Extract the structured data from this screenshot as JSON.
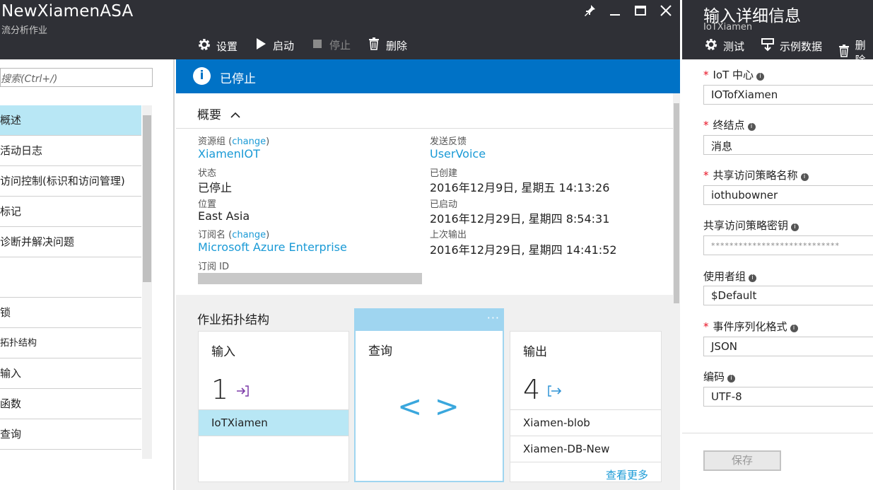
{
  "window": {
    "title": "NewXiamenASA",
    "subtitle": "流分析作业"
  },
  "toolbar": {
    "settings": "设置",
    "start": "启动",
    "stop": "停止",
    "delete": "删除"
  },
  "left": {
    "search_placeholder": "搜索(Ctrl+/)",
    "nav": [
      "概述",
      "活动日志",
      "访问控制(标识和访问管理)",
      "标记",
      "诊断并解决问题",
      "",
      "锁",
      "拓扑结构",
      "输入",
      "函数",
      "查询"
    ]
  },
  "banner": {
    "status": "已停止"
  },
  "essentials": {
    "header": "概要",
    "resource_group_label": "资源组",
    "change": "change",
    "resource_group": "XiamenIOT",
    "status_label": "状态",
    "status": "已停止",
    "location_label": "位置",
    "location": "East Asia",
    "subscription_label": "订阅名",
    "subscription": "Microsoft Azure Enterprise",
    "subscription_id_label": "订阅 ID",
    "feedback_label": "发送反馈",
    "feedback": "UserVoice",
    "created_label": "已创建",
    "created": "2016年12月9日, 星期五 14:13:26",
    "started_label": "已启动",
    "started": "2016年12月29日, 星期四 8:54:31",
    "last_output_label": "上次输出",
    "last_output": "2016年12月29日, 星期四 14:41:52"
  },
  "topology": {
    "title": "作业拓扑结构",
    "inputs": {
      "label": "输入",
      "count": "1",
      "items": [
        "IoTXiamen"
      ]
    },
    "query": {
      "label": "查询",
      "glyph": "< >",
      "more": "···"
    },
    "outputs": {
      "label": "输出",
      "count": "4",
      "items": [
        "Xiamen-blob",
        "Xiamen-DB-New"
      ],
      "see_more": "查看更多"
    }
  },
  "right": {
    "title": "输入详细信息",
    "subtitle": "IoTXiamen",
    "toolbar": {
      "test": "测试",
      "sample": "示例数据",
      "delete": "删除"
    },
    "fields": [
      {
        "label": "IoT 中心",
        "required": true,
        "value": "IOTofXiamen"
      },
      {
        "label": "终结点",
        "required": true,
        "value": "消息"
      },
      {
        "label": "共享访问策略名称",
        "required": true,
        "value": "iothubowner"
      },
      {
        "label": "共享访问策略密钥",
        "required": false,
        "value": "****************************"
      },
      {
        "label": "使用者组",
        "required": false,
        "value": "$Default"
      },
      {
        "label": "事件序列化格式",
        "required": true,
        "value": "JSON"
      },
      {
        "label": "编码",
        "required": false,
        "value": "UTF-8"
      }
    ],
    "save": "保存"
  },
  "colors": {
    "accent": "#0072c6",
    "link": "#1a9ad6",
    "selected": "#b8e7f5",
    "chrome": "#2f3036"
  }
}
